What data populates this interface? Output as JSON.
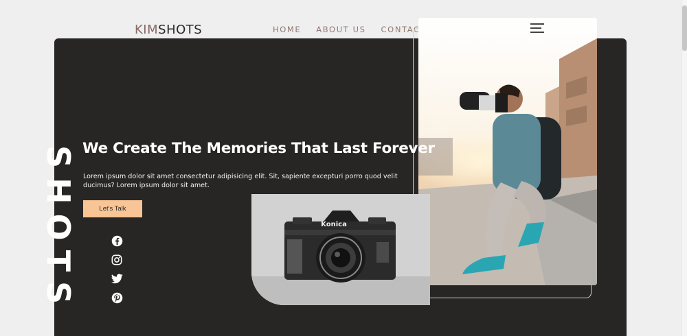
{
  "brand": {
    "part1": "KIM",
    "part2": "SHOTS"
  },
  "nav": {
    "items": [
      "HOME",
      "ABOUT US",
      "CONTACT"
    ]
  },
  "hero": {
    "headline": "We Create The Memories That Last Forever",
    "description": "Lorem ipsum dolor sit amet consectetur adipisicing elit. Sit, sapiente excepturi porro quod velit ducimus? Lorem ipsum dolor sit amet.",
    "cta_label": "Let's Talk",
    "vertical_word": "SHOTS"
  },
  "camera": {
    "brand_label": "Konica"
  },
  "social": [
    "facebook-icon",
    "instagram-icon",
    "twitter-icon",
    "pinterest-icon"
  ],
  "colors": {
    "dark_panel": "#282625",
    "accent": "#f8c596",
    "brand_kim": "#8b6a63",
    "nav": "#8e7a72"
  }
}
